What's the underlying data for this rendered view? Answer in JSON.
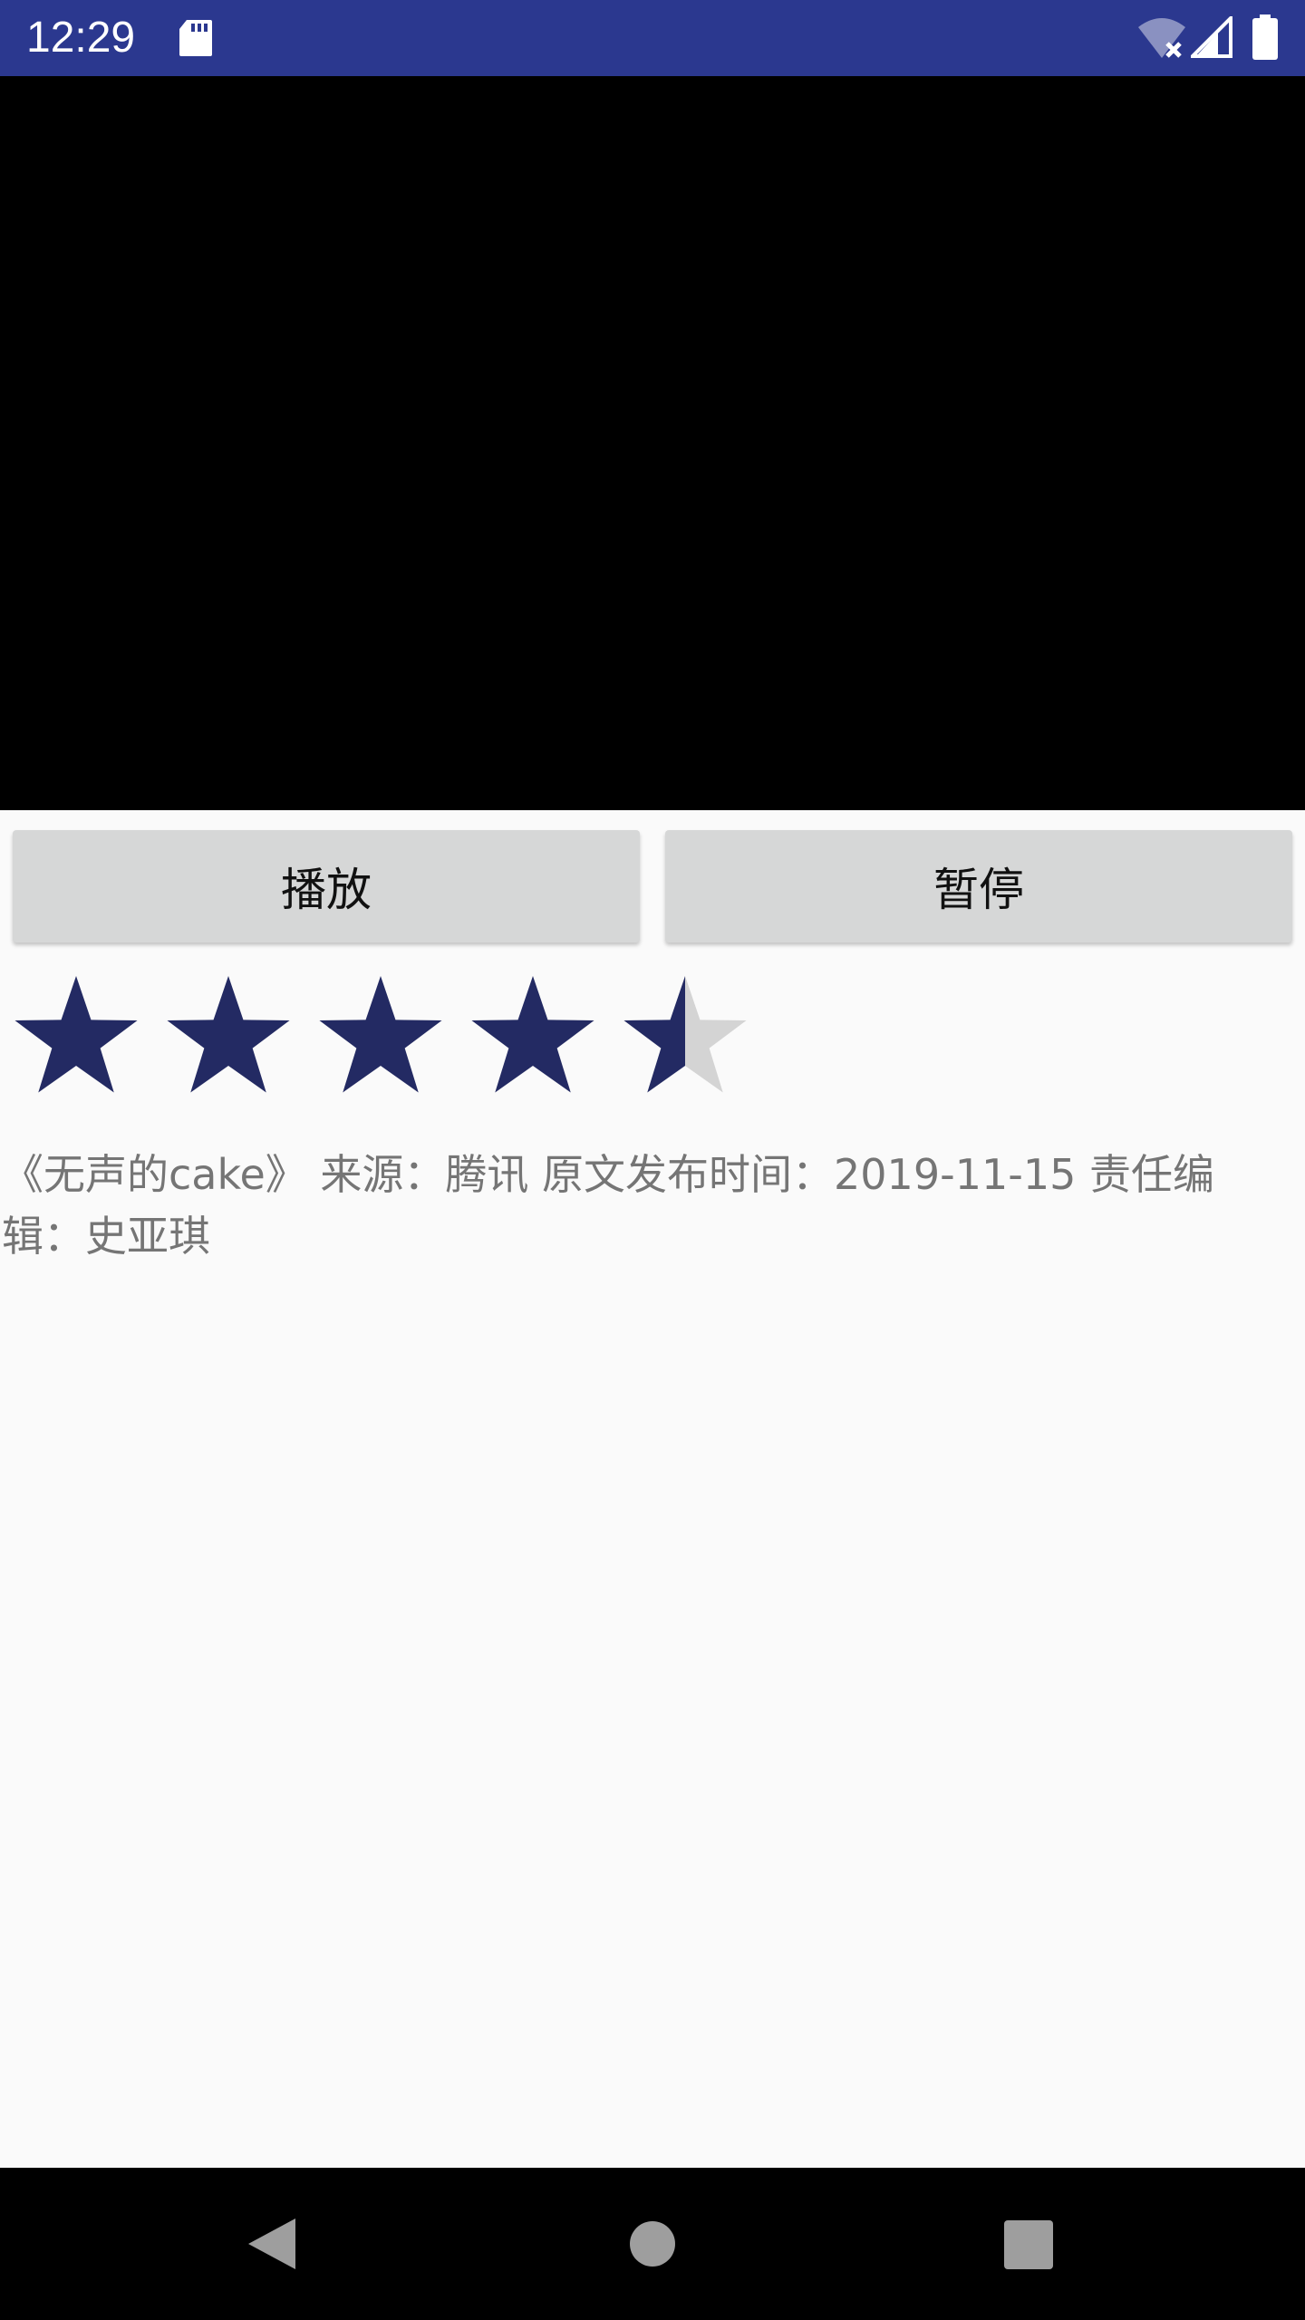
{
  "status_bar": {
    "time": "12:29",
    "icons": [
      "sd-card-icon",
      "wifi-off-icon",
      "cell-signal-icon",
      "battery-icon"
    ],
    "background_color": "#2b388f"
  },
  "video": {
    "background_color": "#000000"
  },
  "controls": {
    "play_label": "播放",
    "pause_label": "暂停"
  },
  "rating": {
    "value": 4.5,
    "max": 5,
    "filled_color": "#232a63",
    "empty_color": "#d4d4d4"
  },
  "description": {
    "text": "《无声的cake》 来源：腾讯 原文发布时间：2019-11-15 责任编辑：史亚琪"
  },
  "nav_bar": {
    "icons": [
      "back-icon",
      "home-icon",
      "recents-icon"
    ]
  }
}
